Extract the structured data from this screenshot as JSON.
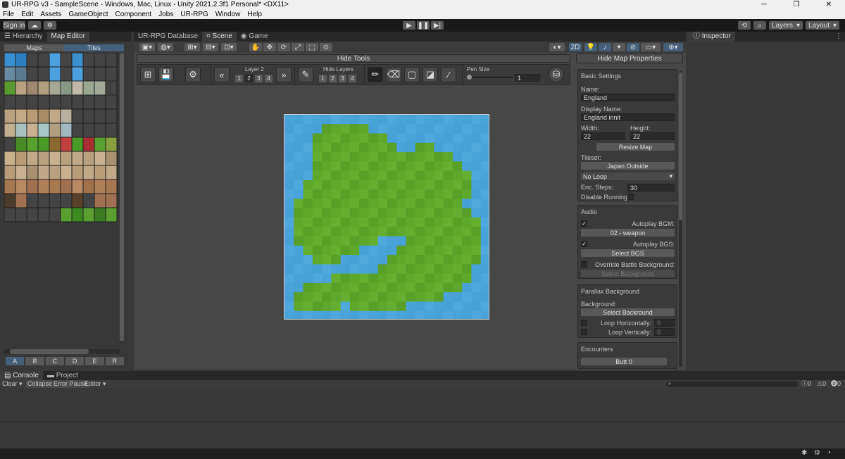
{
  "window": {
    "title": "UR-RPG v3 - SampleScene - Windows, Mac, Linux - Unity 2021.2.3f1 Personal* <DX11>",
    "minimize": "─",
    "maximize": "❐",
    "close": "✕"
  },
  "menu": [
    "File",
    "Edit",
    "Assets",
    "GameObject",
    "Component",
    "Jobs",
    "UR-RPG",
    "Window",
    "Help"
  ],
  "toolbar": {
    "sign_in": "Sign in",
    "layers": "Layers",
    "layout": "Layout"
  },
  "left_tabs": [
    "Hierarchy",
    "Map Editor"
  ],
  "map_editor": {
    "tab_maps": "Maps",
    "tab_tiles": "Tiles",
    "bottom_tabs": [
      "A",
      "B",
      "C",
      "D",
      "E",
      "R"
    ]
  },
  "center_tabs": [
    "UR-RPG Database",
    "Scene",
    "Game"
  ],
  "scene_toolbar": {
    "mode_2d": "2D"
  },
  "tools": {
    "hide_tools": "Hide Tools",
    "layer_label": "Layer 2",
    "layer_buttons": [
      "1",
      "2",
      "3",
      "4"
    ],
    "hide_layers_label": "Hide Layers",
    "hide_layer_buttons": [
      "1",
      "2",
      "3",
      "4"
    ],
    "pen_size_label": "Pen Size",
    "pen_size_value": "1"
  },
  "map_props": {
    "hide_button": "Hide Map Properties",
    "basic_settings": "Basic Settings",
    "name_label": "Name:",
    "name_value": "England",
    "display_name_label": "Display Name:",
    "display_name_value": "England innit",
    "width_label": "Width:",
    "width_value": "22",
    "height_label": "Height:",
    "height_value": "22",
    "resize_button": "Resize Map",
    "tileset_label": "Tileset:",
    "tileset_button": "Japan Outside",
    "loop_select": "No Loop",
    "enc_steps_label": "Enc. Steps:",
    "enc_steps_value": "30",
    "disable_running_label": "Disable Running:",
    "audio": "Audio",
    "autoplay_bgm_label": "Autoplay BGM:",
    "bgm_button": "02 - weapon",
    "autoplay_bgs_label": "Autoplay BGS:",
    "bgs_button": "Select BGS",
    "override_battle_label": "Override Battle Background:",
    "battle_bg_button": "Select Background",
    "parallax": "Parallax Background",
    "background_label": "Background:",
    "parallax_button": "Select Backround",
    "loop_h_label": "Loop Horizontally:",
    "loop_h_value": "0",
    "loop_v_label": "Loop Vertically:",
    "loop_v_value": "0",
    "encounters": "Encounters",
    "encounter_button": "Butt 0"
  },
  "inspector_tab": "Inspector",
  "console": {
    "tabs": [
      "Console",
      "Project"
    ],
    "clear": "Clear",
    "collapse": "Collapse",
    "error_pause": "Error Pause",
    "editor": "Editor",
    "counts": [
      "0",
      "0",
      "0"
    ]
  },
  "map_grid": {
    "size": 22,
    "rows": [
      "wwwwwwwwwwwwwwwwwwwwww",
      "wwwwgggggwwwwwwwwwwwww",
      "wwwggggggggwwwwwwwwwww",
      "wwwgggggggggwwggwwwwww",
      "wwwgggggggggggggggwwww",
      "wwwggggggggggggggggwww",
      "wwwgggggggggggggggggww",
      "wwggggggggggggggggggww",
      "wwggggggggggggggggggww",
      "wggggggggggggggggggwww",
      "wgggggggggggggggggggww",
      "wggggggggggggggggggggw",
      "wggggggggggggggggggggw",
      "wgggggggggwwwggggggggw",
      "wwggggggwwwwgggggggggw",
      "wwwgggwwwwwggggggggggw",
      "wwwwwwwwwwggggggggggww",
      "wwwwwgggggggggggggggww",
      "wwgggggggggggggggggwww",
      "wggggggggggggggggwwwww",
      "wgggggwggggggwwwwwwwww",
      "wwwwwwwwwwwwwwwwwwwwww"
    ]
  },
  "tile_palette": [
    [
      "#3a8fd0",
      "#2e7fc0",
      "#444",
      "#444",
      "#4ca0dd",
      "#444",
      "#3d90d0",
      "#444",
      "#444",
      "#444"
    ],
    [
      "#6a8aa0",
      "#5b7a90",
      "#444",
      "#444",
      "#4ca0dd",
      "#444",
      "#4ca0dd",
      "#444",
      "#444",
      "#444"
    ],
    [
      "#5b9a30",
      "#b8a080",
      "#a08870",
      "#b0a080",
      "#a8a898",
      "#8a9a88",
      "#c0b8a8",
      "#9aa890",
      "#a0a898",
      "#444"
    ],
    [
      "#444",
      "#444",
      "#444",
      "#444",
      "#444",
      "#444",
      "#444",
      "#444",
      "#444",
      "#444"
    ],
    [
      "#b8a080",
      "#c4aa88",
      "#b89c78",
      "#a88c68",
      "#c0a888",
      "#b8b0a0",
      "#444",
      "#444",
      "#444",
      "#444"
    ],
    [
      "#c0b090",
      "#a8c0c0",
      "#c8b090",
      "#a8c8c8",
      "#b0a080",
      "#a0b8c0",
      "#444",
      "#444",
      "#444",
      "#444"
    ],
    [
      "#444",
      "#4a8a28",
      "#5aa030",
      "#4a9a28",
      "#8a6a30",
      "#c04040",
      "#4a9a28",
      "#a83030",
      "#5aa030",
      "#8aa040"
    ],
    [
      "#c8b088",
      "#b89c78",
      "#c0a888",
      "#b8a080",
      "#c8b090",
      "#b8a080",
      "#c0a888",
      "#b8a080",
      "#c8b090",
      "#a89070"
    ],
    [
      "#b89c78",
      "#c8b090",
      "#a89070",
      "#c0a888",
      "#b8a080",
      "#c8b090",
      "#b89c78",
      "#c0a888",
      "#b89c78",
      "#c0a888"
    ],
    [
      "#a87850",
      "#b88860",
      "#a07050",
      "#b08058",
      "#a87850",
      "#a07050",
      "#b88860",
      "#a07048",
      "#b08058",
      "#a87850"
    ],
    [
      "#4a3a2a",
      "#a07050",
      "#444",
      "#444",
      "#444",
      "#444",
      "#5a4028",
      "#444",
      "#a07050",
      "#a07050"
    ],
    [
      "#444",
      "#444",
      "#444",
      "#444",
      "#444",
      "#5aa030",
      "#3a8a20",
      "#5aa030",
      "#3a7a20",
      "#5aa030"
    ]
  ]
}
